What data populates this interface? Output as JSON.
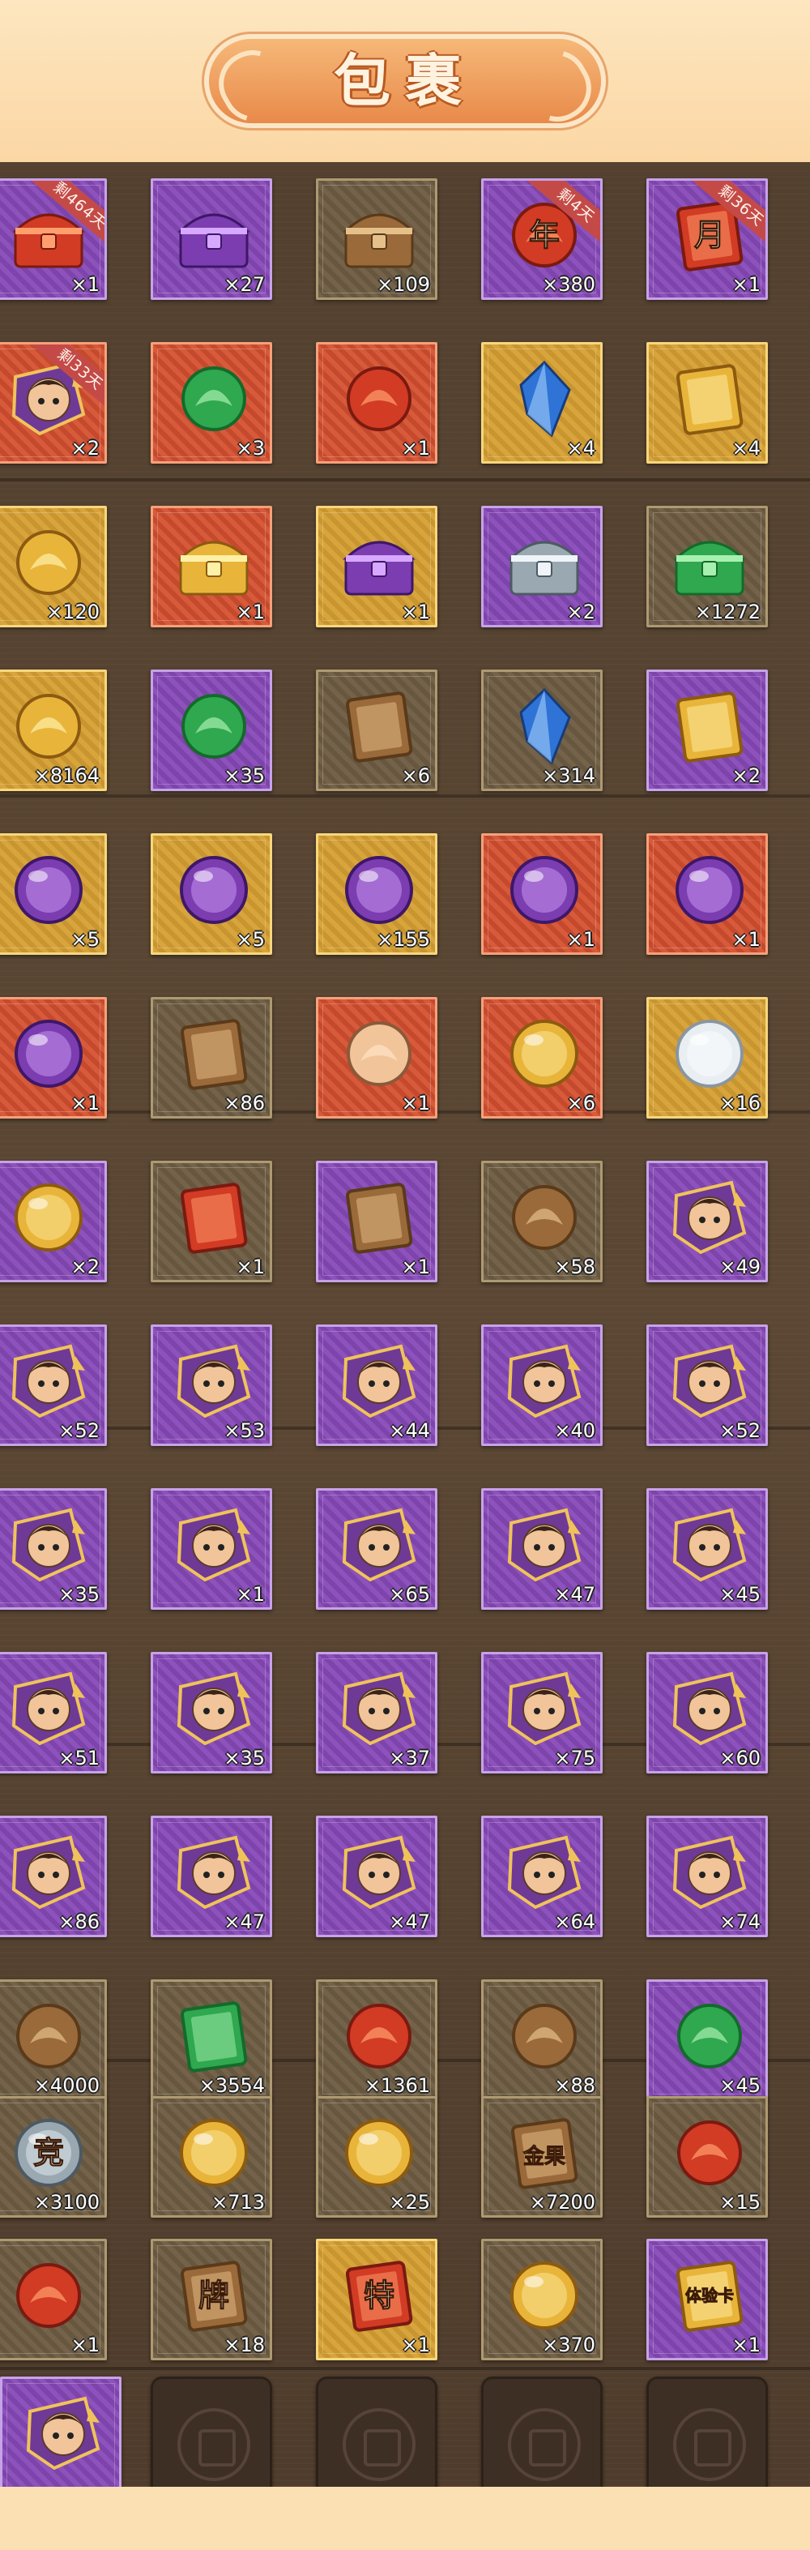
{
  "header": {
    "title": "包裹"
  },
  "colors": {
    "header_bg": "#fbd7a4",
    "grid_bg": "#5b4733",
    "purple": "#8d52bb",
    "gold": "#d8a53c",
    "red": "#d75a3a",
    "brown": "#74634a"
  },
  "items": [
    {
      "quality": "purple",
      "icon": "red-treasure-chest-icon",
      "count": "×1",
      "tag": "剩464天"
    },
    {
      "quality": "purple",
      "icon": "purple-treasure-chest-icon",
      "count": "×27",
      "tag": ""
    },
    {
      "quality": "brown",
      "icon": "wooden-treasure-chest-icon",
      "count": "×109",
      "tag": ""
    },
    {
      "quality": "purple",
      "icon": "new-year-token-icon",
      "count": "×380",
      "tag": "剩4天",
      "glyph": "年"
    },
    {
      "quality": "purple",
      "icon": "month-card-icon",
      "count": "×1",
      "tag": "剩36天",
      "glyph": "月"
    },
    {
      "quality": "red",
      "icon": "hero-portrait-icon",
      "count": "×2",
      "tag": "剩33天"
    },
    {
      "quality": "red",
      "icon": "green-jade-icon",
      "count": "×3",
      "tag": ""
    },
    {
      "quality": "red",
      "icon": "red-jade-icon",
      "count": "×1",
      "tag": ""
    },
    {
      "quality": "gold",
      "icon": "blue-crystal-icon",
      "count": "×4",
      "tag": ""
    },
    {
      "quality": "gold",
      "icon": "gold-ticket-icon",
      "count": "×4",
      "tag": ""
    },
    {
      "quality": "gold",
      "icon": "sky-lantern-icon",
      "count": "×120",
      "tag": ""
    },
    {
      "quality": "red",
      "icon": "gold-chest-icon",
      "count": "×1",
      "tag": ""
    },
    {
      "quality": "gold",
      "icon": "purple-chest-icon",
      "count": "×1",
      "tag": ""
    },
    {
      "quality": "purple",
      "icon": "silver-chest-icon",
      "count": "×2",
      "tag": ""
    },
    {
      "quality": "brown",
      "icon": "jade-chest-icon",
      "count": "×1272",
      "tag": ""
    },
    {
      "quality": "gold",
      "icon": "horse-token-icon",
      "count": "×8164",
      "tag": ""
    },
    {
      "quality": "purple",
      "icon": "green-seal-icon",
      "count": "×35",
      "tag": ""
    },
    {
      "quality": "brown",
      "icon": "map-fragment-icon",
      "count": "×6",
      "tag": ""
    },
    {
      "quality": "brown",
      "icon": "blue-crystal-icon",
      "count": "×314",
      "tag": ""
    },
    {
      "quality": "purple",
      "icon": "gold-fragment-icon",
      "count": "×2",
      "tag": ""
    },
    {
      "quality": "gold",
      "icon": "hero-orb-icon",
      "count": "×5",
      "tag": ""
    },
    {
      "quality": "gold",
      "icon": "hero-orb-icon",
      "count": "×5",
      "tag": ""
    },
    {
      "quality": "gold",
      "icon": "hero-orb-icon",
      "count": "×155",
      "tag": ""
    },
    {
      "quality": "red",
      "icon": "female-hero-orb-icon",
      "count": "×1",
      "tag": ""
    },
    {
      "quality": "red",
      "icon": "male-hero-orb-icon",
      "count": "×1",
      "tag": ""
    },
    {
      "quality": "red",
      "icon": "helmet-hero-orb-icon",
      "count": "×1",
      "tag": ""
    },
    {
      "quality": "brown",
      "icon": "scroll-icon",
      "count": "×86",
      "tag": ""
    },
    {
      "quality": "red",
      "icon": "hero-shrine-icon",
      "count": "×1",
      "tag": ""
    },
    {
      "quality": "red",
      "icon": "gold-pearl-icon",
      "count": "×6",
      "tag": ""
    },
    {
      "quality": "gold",
      "icon": "white-pearl-icon",
      "count": "×16",
      "tag": ""
    },
    {
      "quality": "purple",
      "icon": "gold-egg-icon",
      "count": "×2",
      "tag": ""
    },
    {
      "quality": "brown",
      "icon": "red-scroll-icon",
      "count": "×1",
      "tag": ""
    },
    {
      "quality": "purple",
      "icon": "gold-scroll-icon",
      "count": "×1",
      "tag": ""
    },
    {
      "quality": "brown",
      "icon": "hourglass-icon",
      "count": "×58",
      "tag": ""
    },
    {
      "quality": "purple",
      "icon": "beast-shard-icon",
      "count": "×49",
      "tag": ""
    },
    {
      "quality": "purple",
      "icon": "hero-shard-icon",
      "count": "×52",
      "tag": ""
    },
    {
      "quality": "purple",
      "icon": "hero-shard-icon",
      "count": "×53",
      "tag": ""
    },
    {
      "quality": "purple",
      "icon": "hero-shard-icon",
      "count": "×44",
      "tag": ""
    },
    {
      "quality": "purple",
      "icon": "hero-shard-icon",
      "count": "×40",
      "tag": ""
    },
    {
      "quality": "purple",
      "icon": "hero-shard-icon",
      "count": "×52",
      "tag": ""
    },
    {
      "quality": "purple",
      "icon": "hero-shard-icon",
      "count": "×35",
      "tag": ""
    },
    {
      "quality": "purple",
      "icon": "hero-shard-icon",
      "count": "×1",
      "tag": ""
    },
    {
      "quality": "purple",
      "icon": "hero-shard-icon",
      "count": "×65",
      "tag": ""
    },
    {
      "quality": "purple",
      "icon": "hero-shard-icon",
      "count": "×47",
      "tag": ""
    },
    {
      "quality": "purple",
      "icon": "hero-shard-icon",
      "count": "×45",
      "tag": ""
    },
    {
      "quality": "purple",
      "icon": "hero-shard-icon",
      "count": "×51",
      "tag": ""
    },
    {
      "quality": "purple",
      "icon": "hero-shard-icon",
      "count": "×35",
      "tag": ""
    },
    {
      "quality": "purple",
      "icon": "hero-shard-icon",
      "count": "×37",
      "tag": ""
    },
    {
      "quality": "purple",
      "icon": "hero-shard-icon",
      "count": "×75",
      "tag": ""
    },
    {
      "quality": "purple",
      "icon": "hero-shard-icon",
      "count": "×60",
      "tag": ""
    },
    {
      "quality": "purple",
      "icon": "hero-shard-icon",
      "count": "×86",
      "tag": ""
    },
    {
      "quality": "purple",
      "icon": "hero-shard-icon",
      "count": "×47",
      "tag": ""
    },
    {
      "quality": "purple",
      "icon": "hero-shard-icon",
      "count": "×47",
      "tag": ""
    },
    {
      "quality": "purple",
      "icon": "hero-shard-icon",
      "count": "×64",
      "tag": ""
    },
    {
      "quality": "purple",
      "icon": "hero-shard-icon",
      "count": "×74",
      "tag": ""
    },
    {
      "quality": "brown",
      "icon": "gauntlet-icon",
      "count": "×4000",
      "tag": ""
    },
    {
      "quality": "brown",
      "icon": "jade-tag-icon",
      "count": "×3554",
      "tag": ""
    },
    {
      "quality": "brown",
      "icon": "opera-mask-icon",
      "count": "×1361",
      "tag": ""
    },
    {
      "quality": "brown",
      "icon": "bracer-icon",
      "count": "×88",
      "tag": ""
    },
    {
      "quality": "purple",
      "icon": "upgrade-arrow-icon",
      "count": "×45",
      "tag": ""
    },
    {
      "quality": "brown",
      "icon": "arena-coin-icon",
      "count": "×3100",
      "tag": "",
      "glyph": "竞"
    },
    {
      "quality": "brown",
      "icon": "gold-trophy-coin-icon",
      "count": "×713",
      "tag": ""
    },
    {
      "quality": "brown",
      "icon": "sword-coin-icon",
      "count": "×25",
      "tag": ""
    },
    {
      "quality": "brown",
      "icon": "gold-note-icon",
      "count": "×7200",
      "tag": "",
      "glyph": "金果"
    },
    {
      "quality": "brown",
      "icon": "treasure-pouch-icon",
      "count": "×15",
      "tag": ""
    },
    {
      "quality": "brown",
      "icon": "firecracker-icon",
      "count": "×1",
      "tag": ""
    },
    {
      "quality": "brown",
      "icon": "name-scroll-icon",
      "count": "×18",
      "tag": "",
      "glyph": "牌"
    },
    {
      "quality": "gold",
      "icon": "special-card-icon",
      "count": "×1",
      "tag": "",
      "glyph": "特"
    },
    {
      "quality": "brown",
      "icon": "gold-bean-icon",
      "count": "×370",
      "tag": ""
    },
    {
      "quality": "purple",
      "icon": "trial-card-icon",
      "count": "×1",
      "tag": "",
      "glyph": "体验卡"
    },
    {
      "quality": "purple",
      "icon": "hero-portrait-icon",
      "count": "",
      "tag": ""
    },
    {
      "quality": "lock",
      "icon": "locked-slot-icon",
      "count": "",
      "tag": ""
    },
    {
      "quality": "lock",
      "icon": "locked-slot-icon",
      "count": "",
      "tag": ""
    },
    {
      "quality": "lock",
      "icon": "locked-slot-icon",
      "count": "",
      "tag": ""
    },
    {
      "quality": "lock",
      "icon": "locked-slot-icon",
      "count": "",
      "tag": ""
    }
  ]
}
